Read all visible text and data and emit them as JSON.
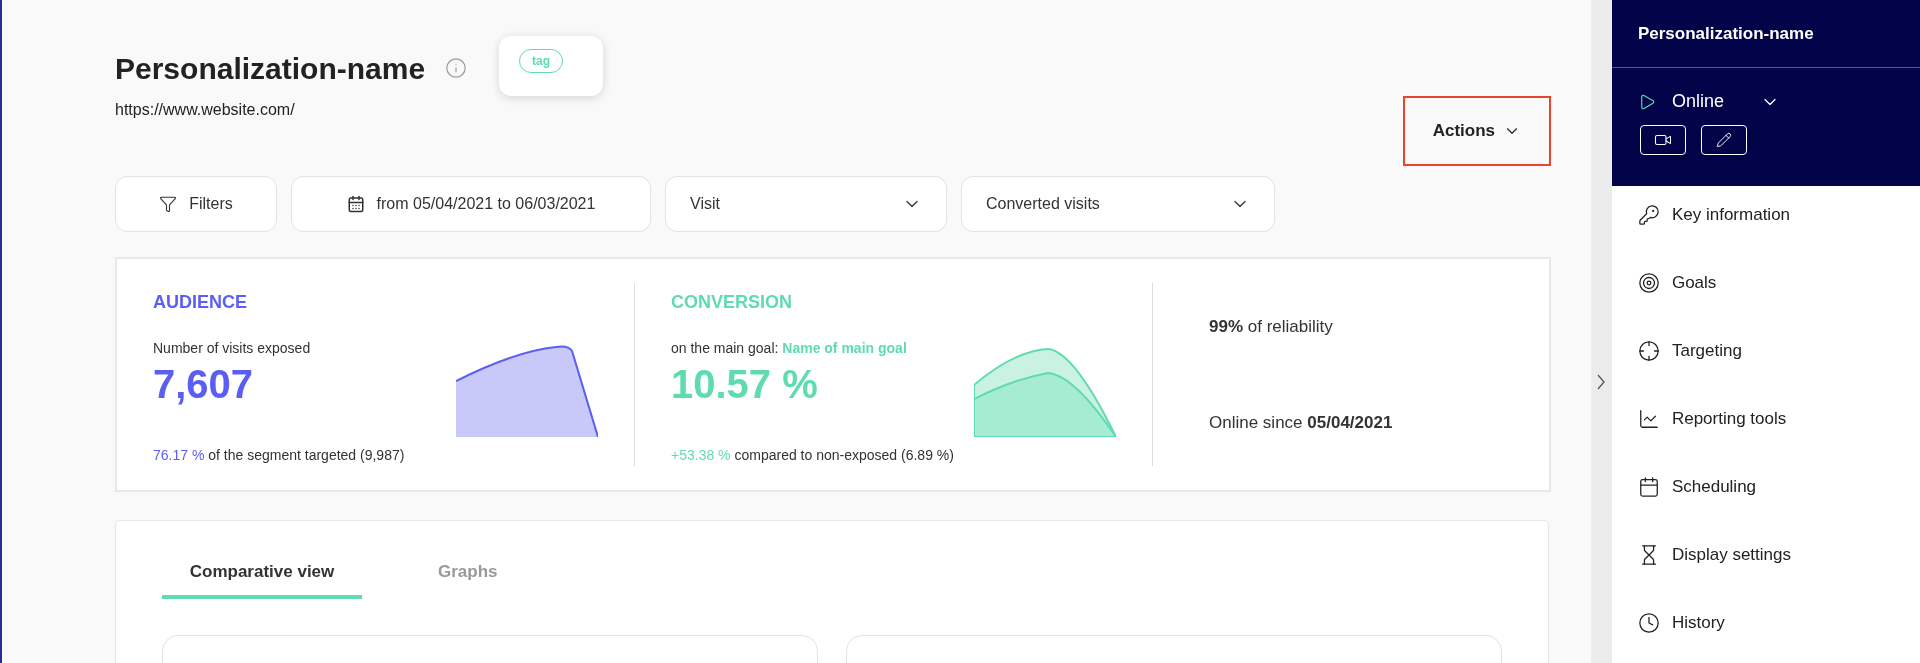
{
  "header": {
    "title": "Personalization-name",
    "tag": "tag",
    "url": "https://www.website.com/",
    "actions": {
      "label": "Actions",
      "highlighted": true
    }
  },
  "filters": {
    "filters_label": "Filters",
    "date_range": "from 05/04/2021 to 06/03/2021",
    "selects": [
      {
        "value": "Visit"
      },
      {
        "value": "Converted visits"
      }
    ]
  },
  "kpis": {
    "audience": {
      "title": "AUDIENCE",
      "label": "Number of visits exposed",
      "value": "7,607",
      "footnote_value": "76.17 %",
      "footnote": "of the segment targeted (9,987)"
    },
    "conversion": {
      "title": "CONVERSION",
      "label": "on the main goal:",
      "goal": "Name of main goal",
      "value": "10.57 %",
      "footnote_value": "+53.38 %",
      "footnote": "compared to non-exposed (6.89 %)"
    },
    "reliability": {
      "value": "99%",
      "label": "of reliability"
    },
    "online_since": {
      "label": "Online since",
      "date": "05/04/2021"
    }
  },
  "tabs": [
    {
      "label": "Comparative view",
      "selected": true
    },
    {
      "label": "Graphs",
      "selected": false
    }
  ],
  "sidebar": {
    "title": "Personalization-name",
    "status": "Online",
    "items": [
      {
        "kind": "key",
        "label": "Key information"
      },
      {
        "kind": "goal",
        "label": "Goals"
      },
      {
        "kind": "target",
        "label": "Targeting"
      },
      {
        "kind": "chart",
        "label": "Reporting tools"
      },
      {
        "kind": "calendar",
        "label": "Scheduling"
      },
      {
        "kind": "hourglass",
        "label": "Display settings"
      },
      {
        "kind": "clock",
        "label": "History"
      }
    ]
  }
}
